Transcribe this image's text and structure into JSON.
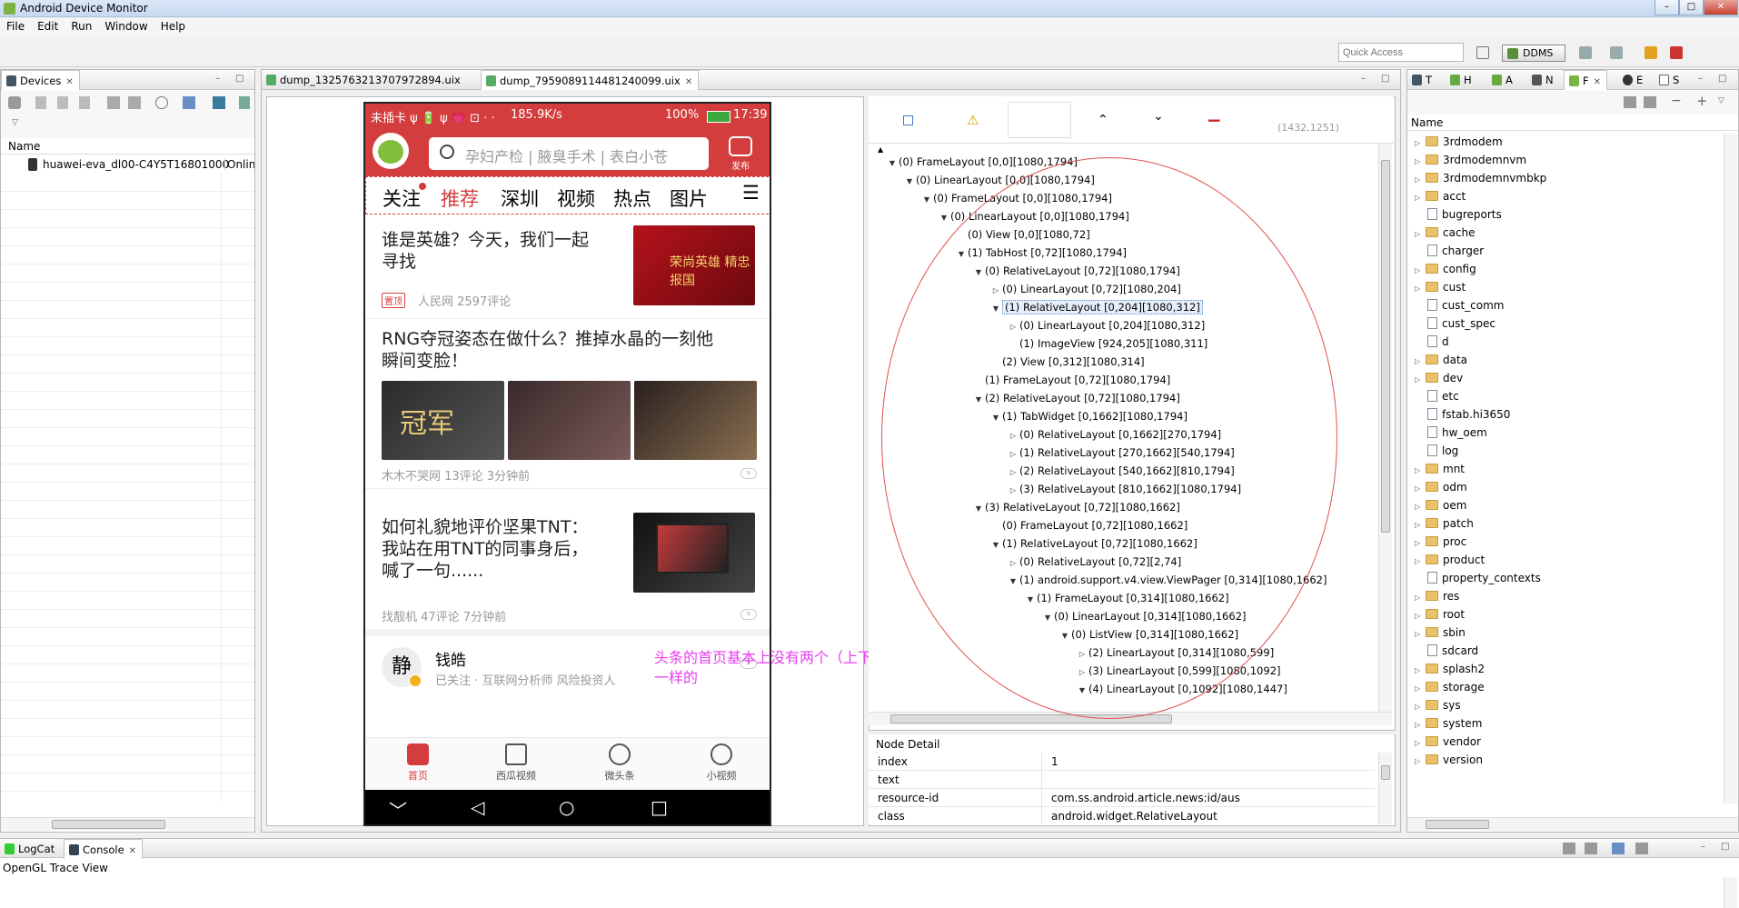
{
  "window": {
    "title": "Android Device Monitor",
    "close_glyph": "✕",
    "minimize_glyph": "–",
    "maximize_glyph": "□"
  },
  "menu": [
    "File",
    "Edit",
    "Run",
    "Window",
    "Help"
  ],
  "toolbar": {
    "quick_access_placeholder": "Quick Access",
    "ddms_label": "DDMS"
  },
  "devices": {
    "tab_label": "Devices",
    "column_name": "Name",
    "device": {
      "name": "huawei-eva_dl00-C4Y5T16801000",
      "status": "Onlin"
    }
  },
  "editor": {
    "tabs": [
      {
        "label": "dump_1325763213707972894.uix"
      },
      {
        "label": "dump_7959089114481240099.uix"
      }
    ]
  },
  "phone": {
    "status_left": "未插卡 ψ 🔋 ψ 💗 ⊡ · ·",
    "speed": "185.9K/s",
    "battery": "100%",
    "time": "17:39",
    "search_placeholder": "孕妇产检 | 腋臭手术 | 表白小苍",
    "publish_label": "发布",
    "tabs": [
      "关注",
      "推荐",
      "深圳",
      "视频",
      "热点",
      "图片"
    ],
    "tab_overflow": "☰",
    "articles": [
      {
        "title_1": "谁是英雄？今天，我们一起",
        "title_2": "寻找",
        "tag": "置顶",
        "meta": "人民网  2597评论",
        "thumb_text": "荣尚英雄 精忠报国"
      },
      {
        "title_1": "RNG夺冠姿态在做什么？推掉水晶的一刻他",
        "title_2": "瞬间变脸！",
        "meta": "木木不哭网  13评论  3分钟前",
        "thumb_text": "冠军"
      },
      {
        "title_1": "如何礼貌地评价坚果TNT：",
        "title_2": "我站在用TNT的同事身后，",
        "title_3": "喊了一句......",
        "meta": "找靓机  47评论  7分钟前"
      },
      {
        "author": "钱皓",
        "author_meta": "已关注 · 互联网分析师 风险投资人",
        "avatar_text": "静"
      }
    ],
    "bottom_nav": [
      "首页",
      "西瓜视频",
      "微头条",
      "小视频"
    ],
    "nav_glyphs": [
      "﹀",
      "◁",
      "○",
      "□"
    ],
    "close_glyph": "✕"
  },
  "annotation": {
    "line_1": "头条的首页基本上没有两个（上下）层级布局",
    "line_2": "一样的"
  },
  "hierarchy": {
    "coords": "(1432,1251)",
    "toolbar_glyphs": {
      "warn": "⚠",
      "up": "⌃",
      "down": "⌄",
      "minus": "−",
      "tree_root": "▲"
    },
    "nodes": [
      {
        "t": "▼",
        "label": "(0) FrameLayout [0,0][1080,1794]",
        "lvl": 1
      },
      {
        "t": "▼",
        "label": "(0) LinearLayout [0,0][1080,1794]",
        "lvl": 2
      },
      {
        "t": "▼",
        "label": "(0) FrameLayout [0,0][1080,1794]",
        "lvl": 3
      },
      {
        "t": "▼",
        "label": "(0) LinearLayout [0,0][1080,1794]",
        "lvl": 4
      },
      {
        "t": "",
        "label": "(0) View [0,0][1080,72]",
        "lvl": 5
      },
      {
        "t": "▼",
        "label": "(1) TabHost [0,72][1080,1794]",
        "lvl": 5
      },
      {
        "t": "▼",
        "label": "(0) RelativeLayout [0,72][1080,1794]",
        "lvl": 6
      },
      {
        "t": "▷",
        "label": "(0) LinearLayout [0,72][1080,204]",
        "lvl": 7
      },
      {
        "t": "▼",
        "label": "(1) RelativeLayout [0,204][1080,312]",
        "lvl": 7,
        "selected": true
      },
      {
        "t": "▷",
        "label": "(0) LinearLayout [0,204][1080,312]",
        "lvl": 8
      },
      {
        "t": "",
        "label": "(1) ImageView [924,205][1080,311]",
        "lvl": 8
      },
      {
        "t": "",
        "label": "(2) View [0,312][1080,314]",
        "lvl": 7
      },
      {
        "t": "",
        "label": "(1) FrameLayout [0,72][1080,1794]",
        "lvl": 6
      },
      {
        "t": "▼",
        "label": "(2) RelativeLayout [0,72][1080,1794]",
        "lvl": 6
      },
      {
        "t": "▼",
        "label": "(1) TabWidget [0,1662][1080,1794]",
        "lvl": 7
      },
      {
        "t": "▷",
        "label": "(0) RelativeLayout [0,1662][270,1794]",
        "lvl": 8
      },
      {
        "t": "▷",
        "label": "(1) RelativeLayout [270,1662][540,1794]",
        "lvl": 8
      },
      {
        "t": "▷",
        "label": "(2) RelativeLayout [540,1662][810,1794]",
        "lvl": 8
      },
      {
        "t": "▷",
        "label": "(3) RelativeLayout [810,1662][1080,1794]",
        "lvl": 8
      },
      {
        "t": "▼",
        "label": "(3) RelativeLayout [0,72][1080,1662]",
        "lvl": 6
      },
      {
        "t": "",
        "label": "(0) FrameLayout [0,72][1080,1662]",
        "lvl": 7
      },
      {
        "t": "▼",
        "label": "(1) RelativeLayout [0,72][1080,1662]",
        "lvl": 7
      },
      {
        "t": "▷",
        "label": "(0) RelativeLayout [0,72][2,74]",
        "lvl": 8
      },
      {
        "t": "▼",
        "label": "(1) android.support.v4.view.ViewPager [0,314][1080,1662]",
        "lvl": 8
      },
      {
        "t": "▼",
        "label": "(1) FrameLayout [0,314][1080,1662]",
        "lvl": 9
      },
      {
        "t": "▼",
        "label": "(0) LinearLayout [0,314][1080,1662]",
        "lvl": 10
      },
      {
        "t": "▼",
        "label": "(0) ListView [0,314][1080,1662]",
        "lvl": 11
      },
      {
        "t": "▷",
        "label": "(2) LinearLayout [0,314][1080,599]",
        "lvl": 12
      },
      {
        "t": "▷",
        "label": "(3) LinearLayout [0,599][1080,1092]",
        "lvl": 12
      },
      {
        "t": "▼",
        "label": "(4) LinearLayout [0,1092][1080,1447]",
        "lvl": 12
      }
    ]
  },
  "node_detail": {
    "title": "Node Detail",
    "rows": [
      {
        "k": "index",
        "v": "1"
      },
      {
        "k": "text",
        "v": ""
      },
      {
        "k": "resource-id",
        "v": "com.ss.android.article.news:id/aus"
      },
      {
        "k": "class",
        "v": "android.widget.RelativeLayout"
      }
    ]
  },
  "file_explorer": {
    "tabs": [
      "T",
      "H",
      "A",
      "N",
      "F",
      "E",
      "S"
    ],
    "column_name": "Name",
    "items": [
      {
        "t": "▷",
        "kind": "dir",
        "name": "3rdmodem"
      },
      {
        "t": "▷",
        "kind": "dir",
        "name": "3rdmodemnvm"
      },
      {
        "t": "▷",
        "kind": "dir",
        "name": "3rdmodemnvmbkp"
      },
      {
        "t": "▷",
        "kind": "dir",
        "name": "acct"
      },
      {
        "t": "",
        "kind": "file",
        "name": "bugreports"
      },
      {
        "t": "▷",
        "kind": "dir",
        "name": "cache"
      },
      {
        "t": "",
        "kind": "file",
        "name": "charger"
      },
      {
        "t": "▷",
        "kind": "dir",
        "name": "config"
      },
      {
        "t": "▷",
        "kind": "dir",
        "name": "cust"
      },
      {
        "t": "",
        "kind": "file",
        "name": "cust_comm"
      },
      {
        "t": "",
        "kind": "file",
        "name": "cust_spec"
      },
      {
        "t": "",
        "kind": "file",
        "name": "d"
      },
      {
        "t": "▷",
        "kind": "dir",
        "name": "data"
      },
      {
        "t": "▷",
        "kind": "dir",
        "name": "dev"
      },
      {
        "t": "",
        "kind": "file",
        "name": "etc"
      },
      {
        "t": "",
        "kind": "file",
        "name": "fstab.hi3650"
      },
      {
        "t": "",
        "kind": "file",
        "name": "hw_oem"
      },
      {
        "t": "",
        "kind": "file",
        "name": "log"
      },
      {
        "t": "▷",
        "kind": "dir",
        "name": "mnt"
      },
      {
        "t": "▷",
        "kind": "dir",
        "name": "odm"
      },
      {
        "t": "▷",
        "kind": "dir",
        "name": "oem"
      },
      {
        "t": "▷",
        "kind": "dir",
        "name": "patch"
      },
      {
        "t": "▷",
        "kind": "dir",
        "name": "proc"
      },
      {
        "t": "▷",
        "kind": "dir",
        "name": "product"
      },
      {
        "t": "",
        "kind": "file",
        "name": "property_contexts"
      },
      {
        "t": "▷",
        "kind": "dir",
        "name": "res"
      },
      {
        "t": "▷",
        "kind": "dir",
        "name": "root"
      },
      {
        "t": "▷",
        "kind": "dir",
        "name": "sbin"
      },
      {
        "t": "",
        "kind": "file",
        "name": "sdcard"
      },
      {
        "t": "▷",
        "kind": "dir",
        "name": "splash2"
      },
      {
        "t": "▷",
        "kind": "dir",
        "name": "storage"
      },
      {
        "t": "▷",
        "kind": "dir",
        "name": "sys"
      },
      {
        "t": "▷",
        "kind": "dir",
        "name": "system"
      },
      {
        "t": "▷",
        "kind": "dir",
        "name": "vendor"
      },
      {
        "t": "▷",
        "kind": "dir",
        "name": "version"
      }
    ]
  },
  "bottom": {
    "tabs": [
      "LogCat",
      "Console"
    ],
    "content": "OpenGL Trace View"
  },
  "colors": {
    "accent_red": "#d43d3d",
    "annotation_magenta": "#e83ef0",
    "ellipse_red": "#e05050"
  }
}
